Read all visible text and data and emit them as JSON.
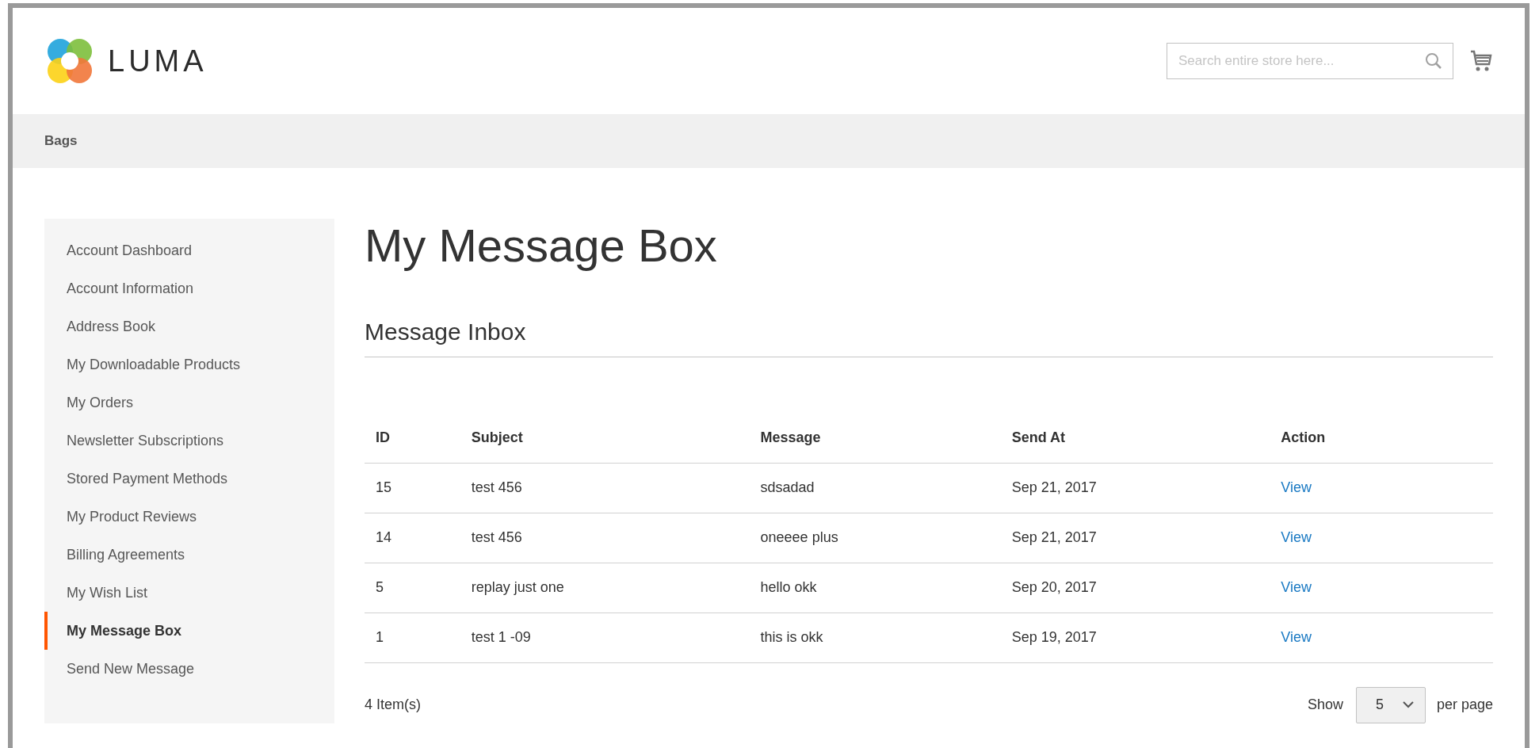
{
  "header": {
    "logo_text": "LUMA",
    "search": {
      "placeholder": "Search entire store here..."
    }
  },
  "nav": {
    "items": [
      {
        "label": "Bags"
      }
    ]
  },
  "sidebar": {
    "items": [
      {
        "label": "Account Dashboard",
        "selected": false
      },
      {
        "label": "Account Information",
        "selected": false
      },
      {
        "label": "Address Book",
        "selected": false
      },
      {
        "label": "My Downloadable Products",
        "selected": false
      },
      {
        "label": "My Orders",
        "selected": false
      },
      {
        "label": "Newsletter Subscriptions",
        "selected": false
      },
      {
        "label": "Stored Payment Methods",
        "selected": false
      },
      {
        "label": "My Product Reviews",
        "selected": false
      },
      {
        "label": "Billing Agreements",
        "selected": false
      },
      {
        "label": "My Wish List",
        "selected": false
      },
      {
        "label": "My Message Box",
        "selected": true
      },
      {
        "label": "Send New Message",
        "selected": false
      }
    ]
  },
  "page_title": "My Message Box",
  "section_title": "Message Inbox",
  "table": {
    "columns": [
      "ID",
      "Subject",
      "Message",
      "Send At",
      "Action"
    ],
    "rows": [
      {
        "id": "15",
        "subject": "test 456",
        "message": "sdsadad",
        "send_at": "Sep 21, 2017",
        "action": "View"
      },
      {
        "id": "14",
        "subject": "test 456",
        "message": "oneeee plus",
        "send_at": "Sep 21, 2017",
        "action": "View"
      },
      {
        "id": "5",
        "subject": "replay just one",
        "message": "hello okk",
        "send_at": "Sep 20, 2017",
        "action": "View"
      },
      {
        "id": "1",
        "subject": "test 1 -09",
        "message": "this is okk",
        "send_at": "Sep 19, 2017",
        "action": "View"
      }
    ]
  },
  "pager": {
    "count": "4 Item(s)",
    "show_label": "Show",
    "per_page_value": "5",
    "per_page_label": "per page"
  }
}
